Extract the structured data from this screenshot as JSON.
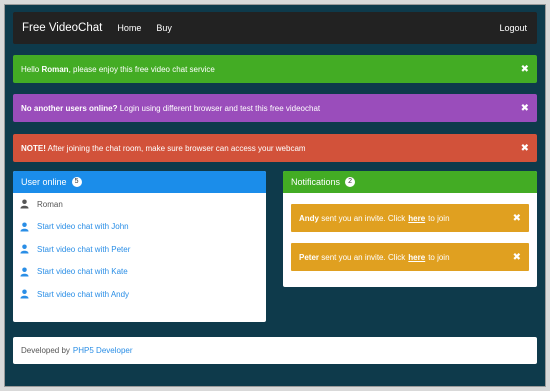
{
  "navbar": {
    "brand": "Free VideoChat",
    "links": [
      "Home",
      "Buy"
    ],
    "logout": "Logout"
  },
  "alerts": [
    {
      "strong": "",
      "pre": "Hello ",
      "bold": "Roman",
      "post": ", please enjoy this free video chat service",
      "color": "#43ac24"
    },
    {
      "bold": "No another users online?",
      "post": " Login using different browser and test this free videochat",
      "color": "#9a4dbb"
    },
    {
      "bold": "NOTE!",
      "post": " After joining the chat room, make sure browser can access your webcam",
      "color": "#d2523a"
    }
  ],
  "close_symbol": "✖",
  "users_panel": {
    "title": "User online",
    "count": "5",
    "self_name": "Roman",
    "links": [
      "Start video chat with John",
      "Start video chat with Peter",
      "Start video chat with Kate",
      "Start video chat with Andy"
    ]
  },
  "notifications_panel": {
    "title": "Notifications",
    "count": "2",
    "items": [
      {
        "name": "Andy",
        "text": " sent you an invite. Click",
        "link": "here",
        "suffix": "to join"
      },
      {
        "name": "Peter",
        "text": " sent you an invite. Click",
        "link": "here",
        "suffix": "to join"
      }
    ]
  },
  "footer": {
    "prefix": "Developed by",
    "link": "PHP5 Developer"
  },
  "colors": {
    "background": "#0e3a4b",
    "primary": "#1b8dea",
    "success": "#43ac24",
    "warning": "#e0a020"
  },
  "icons": {
    "user": "user-icon",
    "close": "close-icon"
  }
}
